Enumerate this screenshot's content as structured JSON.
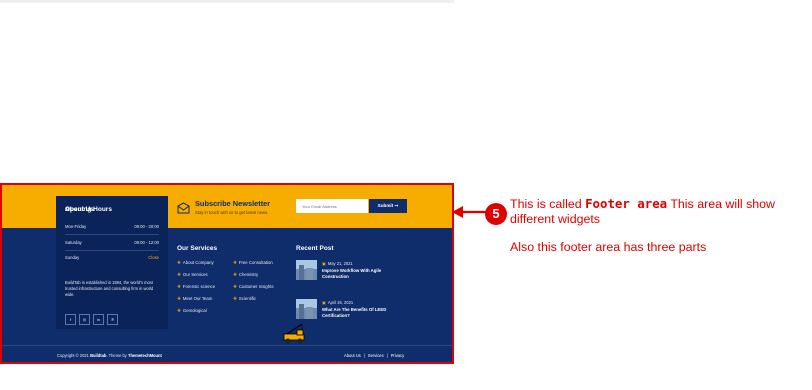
{
  "colors": {
    "accent": "#f7ad00",
    "navy": "#0f2d6b",
    "annotation": "#e10000"
  },
  "hours": {
    "title": "Opening Hours",
    "rows": [
      {
        "day": "Mon-Friday",
        "time": "09:00 - 20:00"
      },
      {
        "day": "Saturday",
        "time": "09:00 - 12:00"
      },
      {
        "day": "Sunday",
        "time": "Close"
      }
    ]
  },
  "about": {
    "title": "About Us",
    "text": "BuildTab is established in 1984, the world's most trusted infrastructure and consulting firm in world wide.",
    "socials": [
      "f",
      "◎",
      "in",
      "℗"
    ]
  },
  "newsletter": {
    "title": "Subscribe Newsletter",
    "subtitle": "Stay in touch with us to get latest news.",
    "email_placeholder": "Your Email Address",
    "submit_label": "Submit ➞",
    "icon": "envelope-icon"
  },
  "services": {
    "title": "Our Services",
    "col1": [
      "About Company",
      "Our Services",
      "Forensic science",
      "Meet Our Team",
      "Gemological"
    ],
    "col2": [
      "Free Consultation",
      "Chemistry",
      "Customer Insights",
      "Scientific"
    ]
  },
  "recent": {
    "title": "Recent Post",
    "posts": [
      {
        "date": "May 21, 2021",
        "title": "Improve Workflow With Agile Construction"
      },
      {
        "date": "April 26, 2021",
        "title": "What Are The Benefits Of LEED Certification?"
      }
    ]
  },
  "copyright": {
    "prefix": "Copyright © 2021",
    "brand": "Buildtab",
    "mid": ". Theme by",
    "author": "ThemetechMount"
  },
  "legal_links": [
    "About Us",
    "Services",
    "Privacy"
  ],
  "legal_sep": "|",
  "annotation": {
    "badge": "5",
    "line1_a": "This is called ",
    "line1_bold": "Footer area",
    "line1_b": " This area will show different widgets",
    "line2": "Also this footer area has three parts"
  }
}
